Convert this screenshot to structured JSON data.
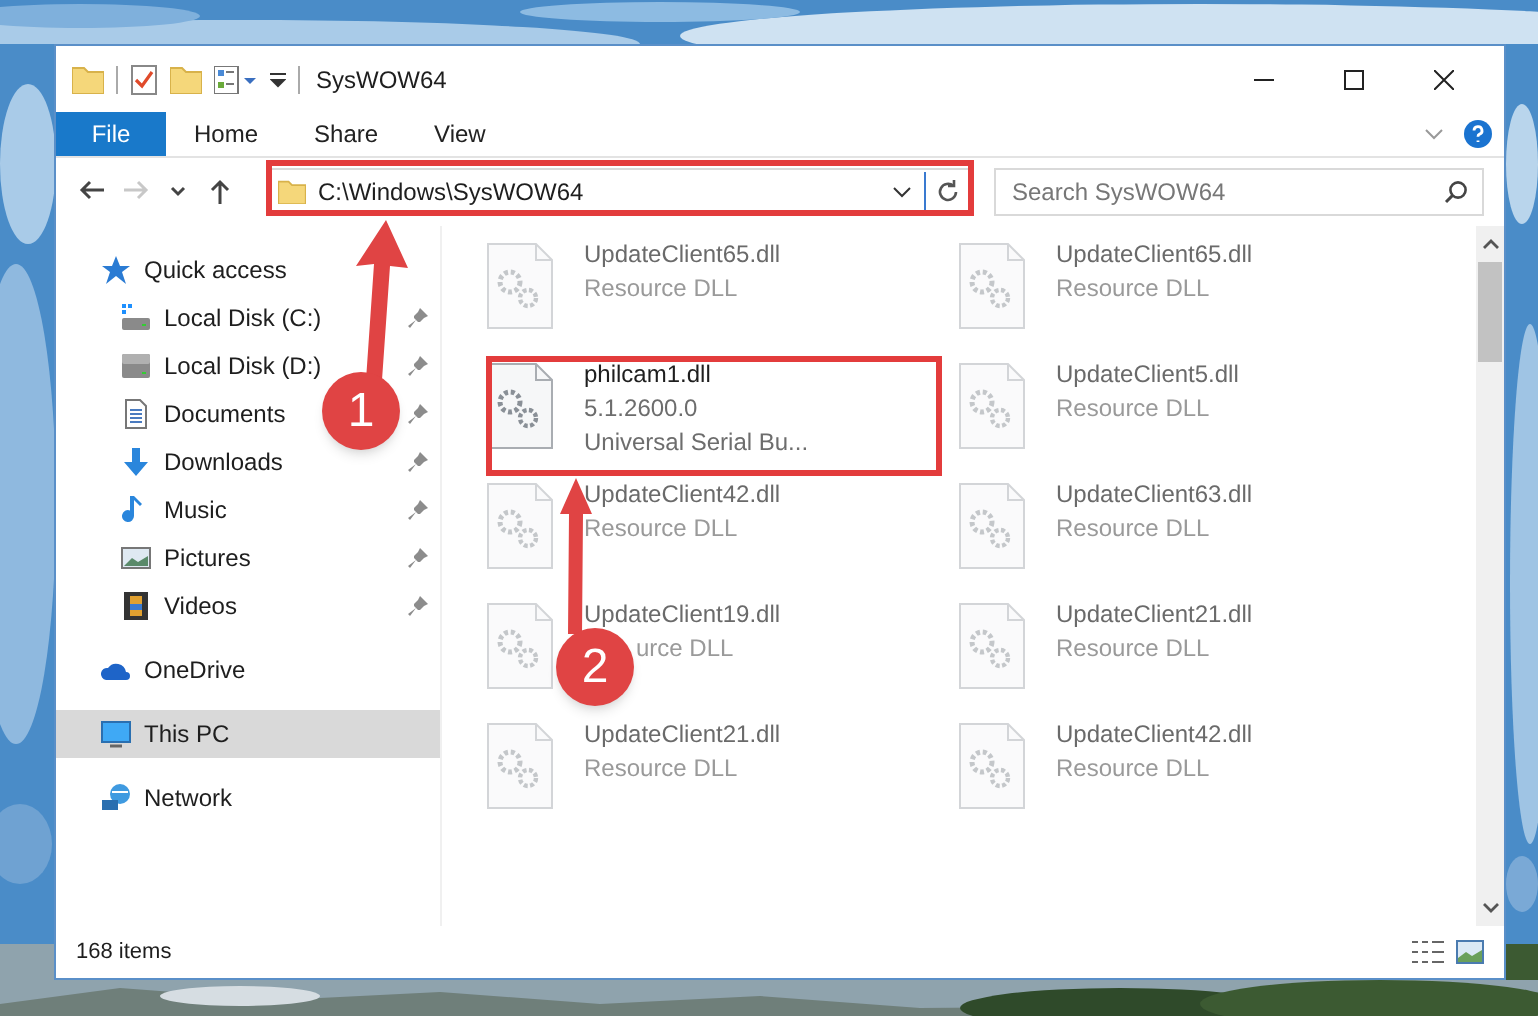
{
  "window": {
    "title": "SysWOW64"
  },
  "ribbon_tabs": [
    {
      "label": "File",
      "kind": "file"
    },
    {
      "label": "Home",
      "kind": "tab"
    },
    {
      "label": "Share",
      "kind": "tab"
    },
    {
      "label": "View",
      "kind": "tab"
    }
  ],
  "nav": [
    {
      "kind": "back",
      "disabled": false
    },
    {
      "kind": "forward",
      "disabled": true
    },
    {
      "kind": "recent",
      "disabled": false
    },
    {
      "kind": "up",
      "disabled": false
    }
  ],
  "address": {
    "value": "C:\\Windows\\SysWOW64"
  },
  "search": {
    "placeholder": "Search SysWOW64"
  },
  "sidebar": {
    "items": [
      {
        "label": "Quick access",
        "kind": "star",
        "selected": false,
        "children": [
          {
            "label": "Local Disk (C:)",
            "kind": "system-drive",
            "pinned": true,
            "selected": false
          },
          {
            "label": "Local Disk (D:)",
            "kind": "drive",
            "pinned": true,
            "selected": false
          },
          {
            "label": "Documents",
            "kind": "documents",
            "pinned": true,
            "selected": false
          },
          {
            "label": "Downloads",
            "kind": "downloads",
            "pinned": true,
            "selected": false
          },
          {
            "label": "Music",
            "kind": "music",
            "pinned": true,
            "selected": false
          },
          {
            "label": "Pictures",
            "kind": "pictures",
            "pinned": true,
            "selected": false
          },
          {
            "label": "Videos",
            "kind": "videos",
            "pinned": true,
            "selected": false
          }
        ]
      },
      {
        "label": "OneDrive",
        "kind": "cloud",
        "selected": false
      },
      {
        "label": "This PC",
        "kind": "pc",
        "selected": true
      },
      {
        "label": "Network",
        "kind": "network",
        "selected": false
      }
    ]
  },
  "files": [
    {
      "name": "UpdateClient65.dll",
      "details": [
        "Resource DLL"
      ],
      "faded": true
    },
    {
      "name": "UpdateClient65.dll",
      "details": [
        "Resource DLL"
      ],
      "faded": true
    },
    {
      "name": "philcam1.dll",
      "details": [
        "5.1.2600.0",
        "Universal Serial Bu..."
      ],
      "faded": false
    },
    {
      "name": "UpdateClient5.dll",
      "details": [
        "Resource DLL"
      ],
      "faded": true
    },
    {
      "name": "UpdateClient42.dll",
      "details": [
        "Resource DLL"
      ],
      "faded": true
    },
    {
      "name": "UpdateClient63.dll",
      "details": [
        "Resource DLL"
      ],
      "faded": true
    },
    {
      "name": "UpdateClient19.dll",
      "details": [
        "urce DLL"
      ],
      "faded": true,
      "covered": true
    },
    {
      "name": "UpdateClient21.dll",
      "details": [
        "Resource DLL"
      ],
      "faded": true
    },
    {
      "name": "UpdateClient21.dll",
      "details": [
        "Resource DLL"
      ],
      "faded": true
    },
    {
      "name": "UpdateClient42.dll",
      "details": [
        "Resource DLL"
      ],
      "faded": true
    }
  ],
  "status_bar": {
    "count": "168 items"
  },
  "annotations": [
    {
      "label": "1"
    },
    {
      "label": "2"
    }
  ]
}
